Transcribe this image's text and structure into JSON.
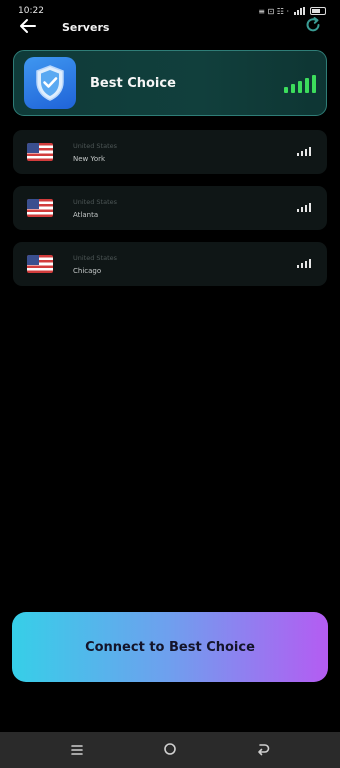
{
  "status_bar": {
    "time": "10:22",
    "indicators": "≡ ⊡ ☷ ·"
  },
  "header": {
    "title": "Servers",
    "back_icon": "back-arrow-icon",
    "refresh_icon": "refresh-icon"
  },
  "best_choice": {
    "label": "Best Choice",
    "icon": "shield-check-icon",
    "signal_bars": 5
  },
  "servers": [
    {
      "country": "United States",
      "city": "New York",
      "flag": "us-flag-icon",
      "signal_bars": 4
    },
    {
      "country": "United States",
      "city": "Atlanta",
      "flag": "us-flag-icon",
      "signal_bars": 4
    },
    {
      "country": "United States",
      "city": "Chicago",
      "flag": "us-flag-icon",
      "signal_bars": 4
    }
  ],
  "connect_button": {
    "label": "Connect to Best Choice"
  },
  "nav_bar": {
    "icons": [
      "menu-icon",
      "home-icon",
      "back-icon"
    ]
  },
  "colors": {
    "background": "#000000",
    "best_card": "#0f3b39",
    "best_card_border": "#2f7d77",
    "signal_green": "#3cdd5c",
    "server_card": "#0f1616",
    "gradient_start": "#36cfe8",
    "gradient_end": "#b45cf2"
  }
}
